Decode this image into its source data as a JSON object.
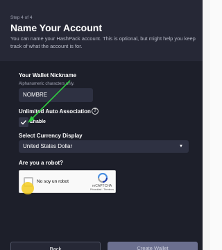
{
  "header": {
    "step": "Step 4 of 4",
    "title": "Name Your Account",
    "description": "You can name your HashPack account. This is optional, but might help you keep track of what the account is for."
  },
  "nickname": {
    "label": "Your Wallet Nickname",
    "hint": "Alphanumeric characters only.",
    "value": "NOMBRE"
  },
  "auto_association": {
    "label": "Unlimited Auto Association",
    "info_icon": "info-icon",
    "checkbox_label": "Enable",
    "checked": true
  },
  "currency": {
    "label": "Select Currency Display",
    "selected": "United States Dollar"
  },
  "robot": {
    "label": "Are you a robot?",
    "checkbox_text": "No soy un robot",
    "brand": "reCAPTCHA",
    "terms": "Privacidad - Términos"
  },
  "buttons": {
    "back": "Back",
    "create": "Create Wallet"
  },
  "colors": {
    "background": "#1d1f2a",
    "header": "#262836",
    "input": "#2e3142",
    "annotation_arrow": "#2ecc40",
    "cursor_highlight": "#f4cd1e"
  }
}
